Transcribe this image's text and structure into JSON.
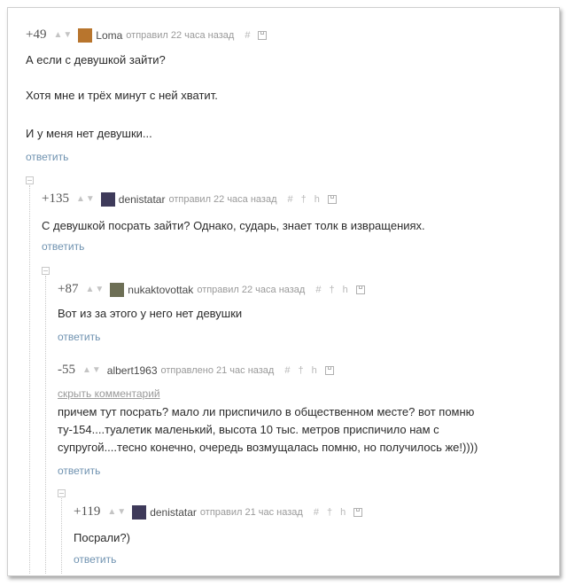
{
  "comments": [
    {
      "rating": "+49",
      "author": "Loma",
      "time": "отправил 22 часа назад",
      "lines": [
        "А если с девушкой зайти?",
        "Хотя мне и трёх минут с ней хватит.",
        "И у меня нет девушки..."
      ],
      "reply": "ответить",
      "avatar_color": "#b8752d"
    },
    {
      "rating": "+135",
      "author": "denistatar",
      "time": "отправил 22 часа назад",
      "lines": [
        "С девушкой посрать зайти? Однако, сударь, знает толк в извращениях."
      ],
      "reply": "ответить",
      "avatar_color": "#3e3a5a"
    },
    {
      "rating": "+87",
      "author": "nukaktovottak",
      "time": "отправил 22 часа назад",
      "lines": [
        "Вот из за этого у него нет девушки"
      ],
      "reply": "ответить",
      "avatar_color": "#6d6f55"
    },
    {
      "rating": "-55",
      "author": "albert1963",
      "time": "отправлено 21 час назад",
      "hide_label": "скрыть комментарий",
      "lines": [
        "причем тут посрать? мало ли приспичило в общественном месте? вот помню",
        "ту-154....туалетик маленький, высота 10 тыс. метров приспичило нам с",
        "супругой....тесно конечно, очередь возмущалась помню, но получилось же!))))"
      ],
      "reply": "ответить"
    },
    {
      "rating": "+119",
      "author": "denistatar",
      "time": "отправил 21 час назад",
      "lines": [
        "Посрали?)"
      ],
      "reply": "ответить",
      "avatar_color": "#3e3a5a"
    }
  ],
  "icons": {
    "vote": "▲▼",
    "hash": "#",
    "arrow": "†",
    "branch": "h"
  }
}
